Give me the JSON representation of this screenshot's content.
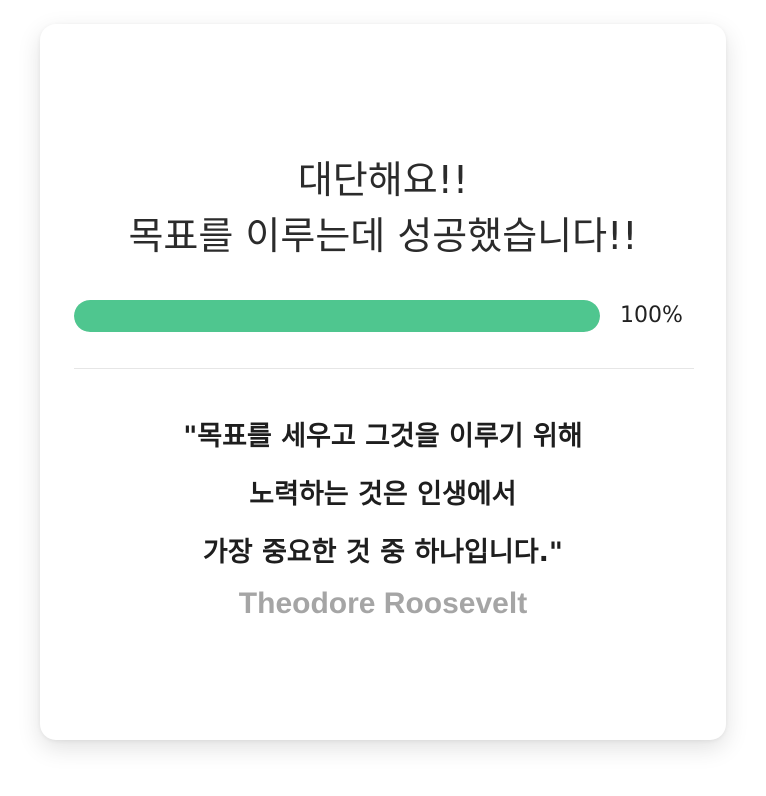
{
  "success": {
    "title_lines": [
      "대단해요!!",
      "목표를 이루는데 성공했습니다!!"
    ],
    "progress": {
      "value": 100,
      "label": "100%",
      "color": "#4fc68f"
    },
    "quote": {
      "lines": [
        "\"목표를 세우고 그것을 이루기 위해",
        "노력하는 것은 인생에서",
        "가장 중요한 것 중 하나입니다.\""
      ],
      "author": "Theodore Roosevelt"
    }
  }
}
